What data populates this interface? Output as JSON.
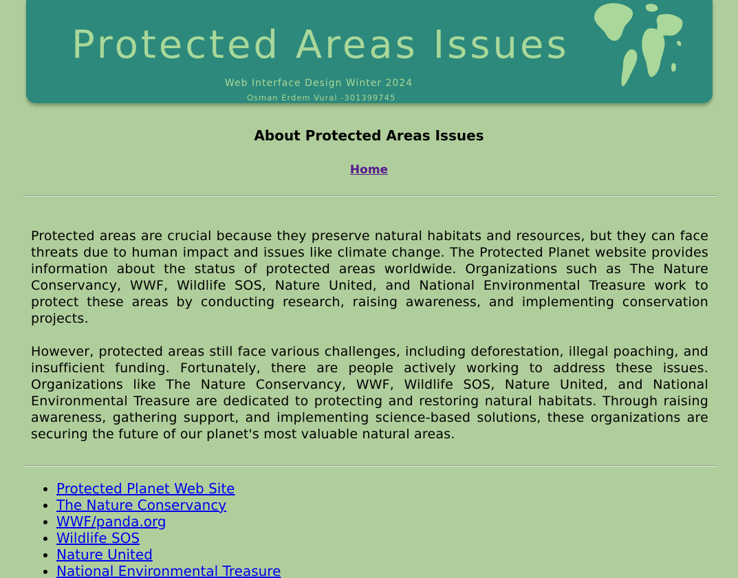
{
  "banner": {
    "title": "Protected Areas Issues",
    "subtitle": "Web Interface Design Winter 2024",
    "author": "Osman Erdem Vural -301399745",
    "globe_icon": "globe-icon"
  },
  "header": {
    "title": "About Protected Areas Issues",
    "home_link": "Home"
  },
  "content": {
    "paragraphs": [
      "Protected areas are crucial because they preserve natural habitats and resources, but they can face threats due to human impact and issues like climate change. The Protected Planet website provides information about the status of protected areas worldwide. Organizations such as The Nature Conservancy, WWF, Wildlife SOS, Nature United, and National Environmental Treasure work to protect these areas by conducting research, raising awareness, and implementing conservation projects.",
      "However, protected areas still face various challenges, including deforestation, illegal poaching, and insufficient funding. Fortunately, there are people actively working to address these issues. Organizations like The Nature Conservancy, WWF, Wildlife SOS, Nature United, and National Environmental Treasure are dedicated to protecting and restoring natural habitats. Through raising awareness, gathering support, and implementing science-based solutions, these organizations are securing the future of our planet's most valuable natural areas."
    ]
  },
  "links": [
    "Protected Planet Web Site",
    "The Nature Conservancy",
    "WWF/panda.org",
    "Wildlife SOS",
    "Nature United",
    "National Environmental Treasure"
  ],
  "colors": {
    "background": "#b0ce9c",
    "banner": "#2d897b",
    "banner_text": "#a9d89a",
    "link": "#0000ee",
    "visited_link": "#551a8b"
  }
}
